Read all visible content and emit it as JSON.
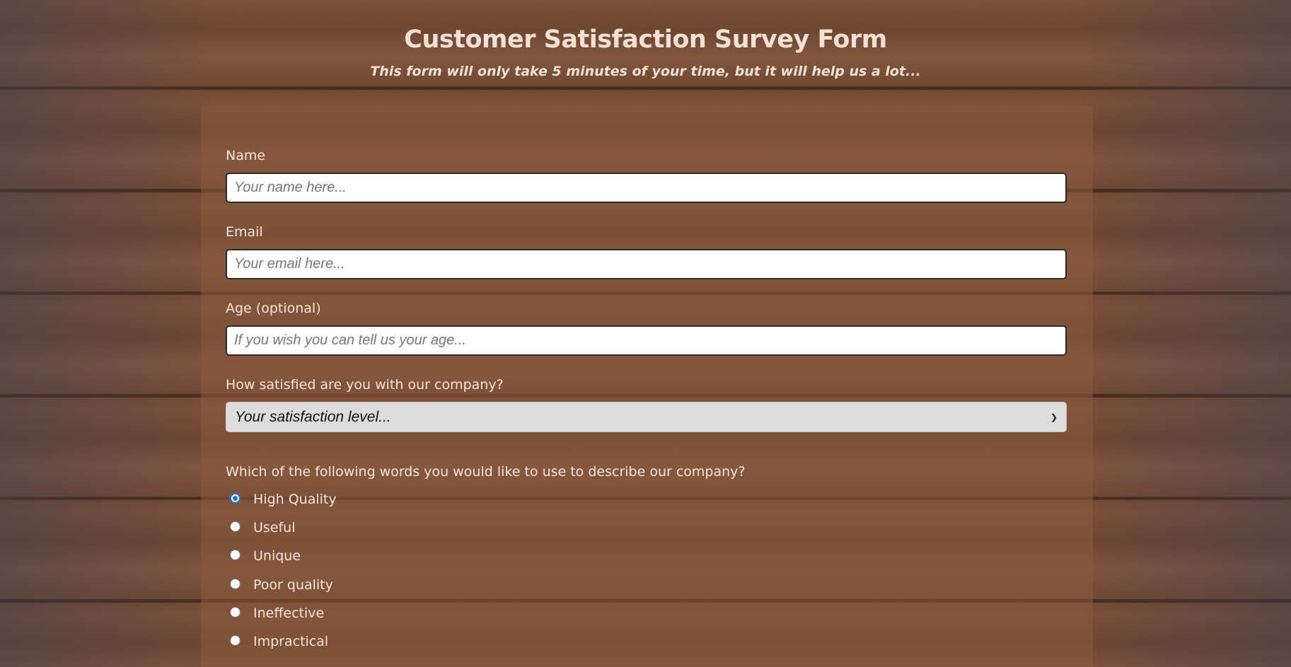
{
  "header": {
    "title": "Customer Satisfaction Survey Form",
    "subtitle": "This form will only take 5 minutes of your time, but it will help us a lot..."
  },
  "form": {
    "name": {
      "label": "Name",
      "placeholder": "Your name here...",
      "value": ""
    },
    "email": {
      "label": "Email",
      "placeholder": "Your email here...",
      "value": ""
    },
    "age": {
      "label": "Age (optional)",
      "placeholder": "If you wish you can tell us your age...",
      "value": ""
    },
    "satisfaction": {
      "label": "How satisfied are you with our company?",
      "selected": "Your satisfaction level..."
    },
    "describe": {
      "label": "Which of the following words you would like to use to describe our company?",
      "options": [
        {
          "label": "High Quality",
          "checked": true
        },
        {
          "label": "Useful",
          "checked": false
        },
        {
          "label": "Unique",
          "checked": false
        },
        {
          "label": "Poor quality",
          "checked": false
        },
        {
          "label": "Ineffective",
          "checked": false
        },
        {
          "label": "Impractical",
          "checked": false
        }
      ]
    }
  },
  "colors": {
    "accent": "#1a73e8",
    "text": "#f4e6dc",
    "panel": "#8c5a3e"
  }
}
